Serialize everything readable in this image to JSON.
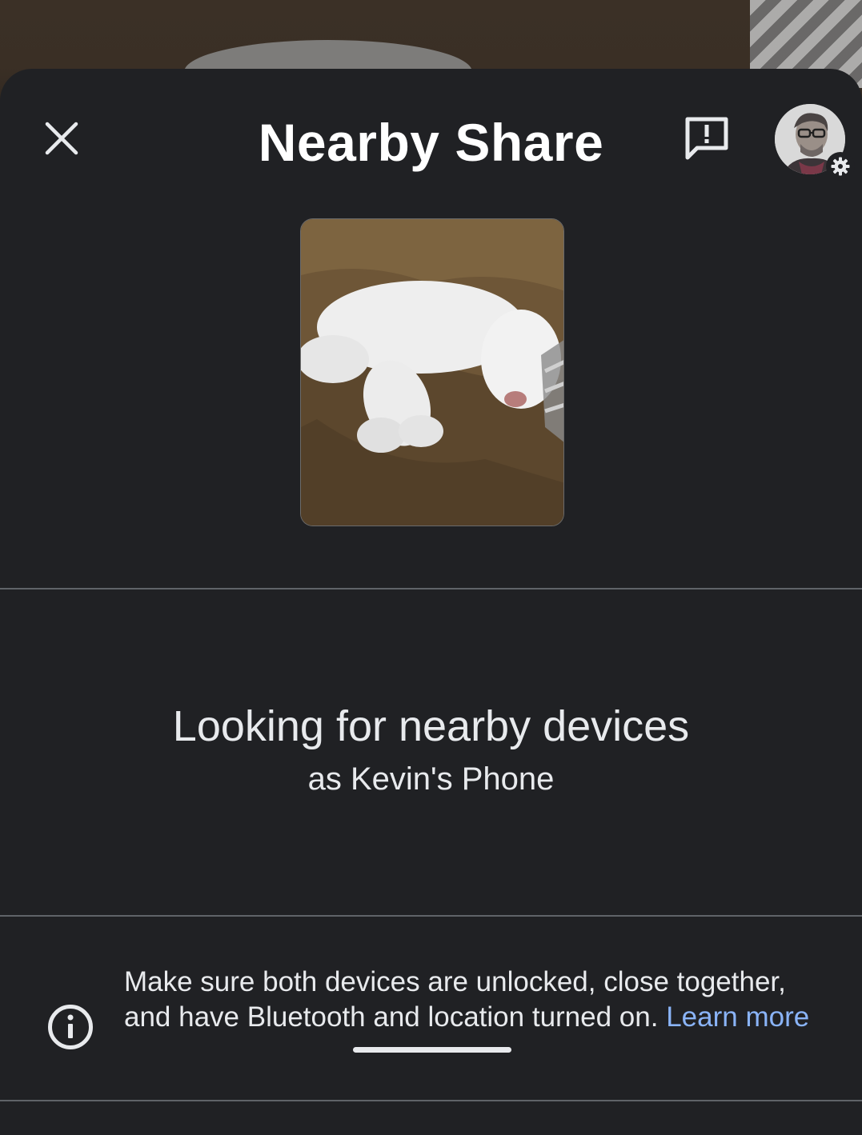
{
  "header": {
    "title": "Nearby Share",
    "close_icon": "close-icon",
    "feedback_icon": "feedback-icon",
    "avatar_icon": "profile-avatar",
    "settings_badge_icon": "gear-icon"
  },
  "preview": {
    "icon": "shared-photo-thumbnail"
  },
  "status": {
    "title": "Looking for nearby devices",
    "subtitle": "as Kevin's Phone"
  },
  "hint": {
    "icon": "info-icon",
    "text": "Make sure both devices are unlocked, close together, and have Bluetooth and location turned on.",
    "link_label": "Learn more"
  },
  "colors": {
    "sheet_background": "#202124",
    "primary_text": "#e8eaed",
    "link": "#8ab4f8",
    "divider": "#5f6368"
  }
}
